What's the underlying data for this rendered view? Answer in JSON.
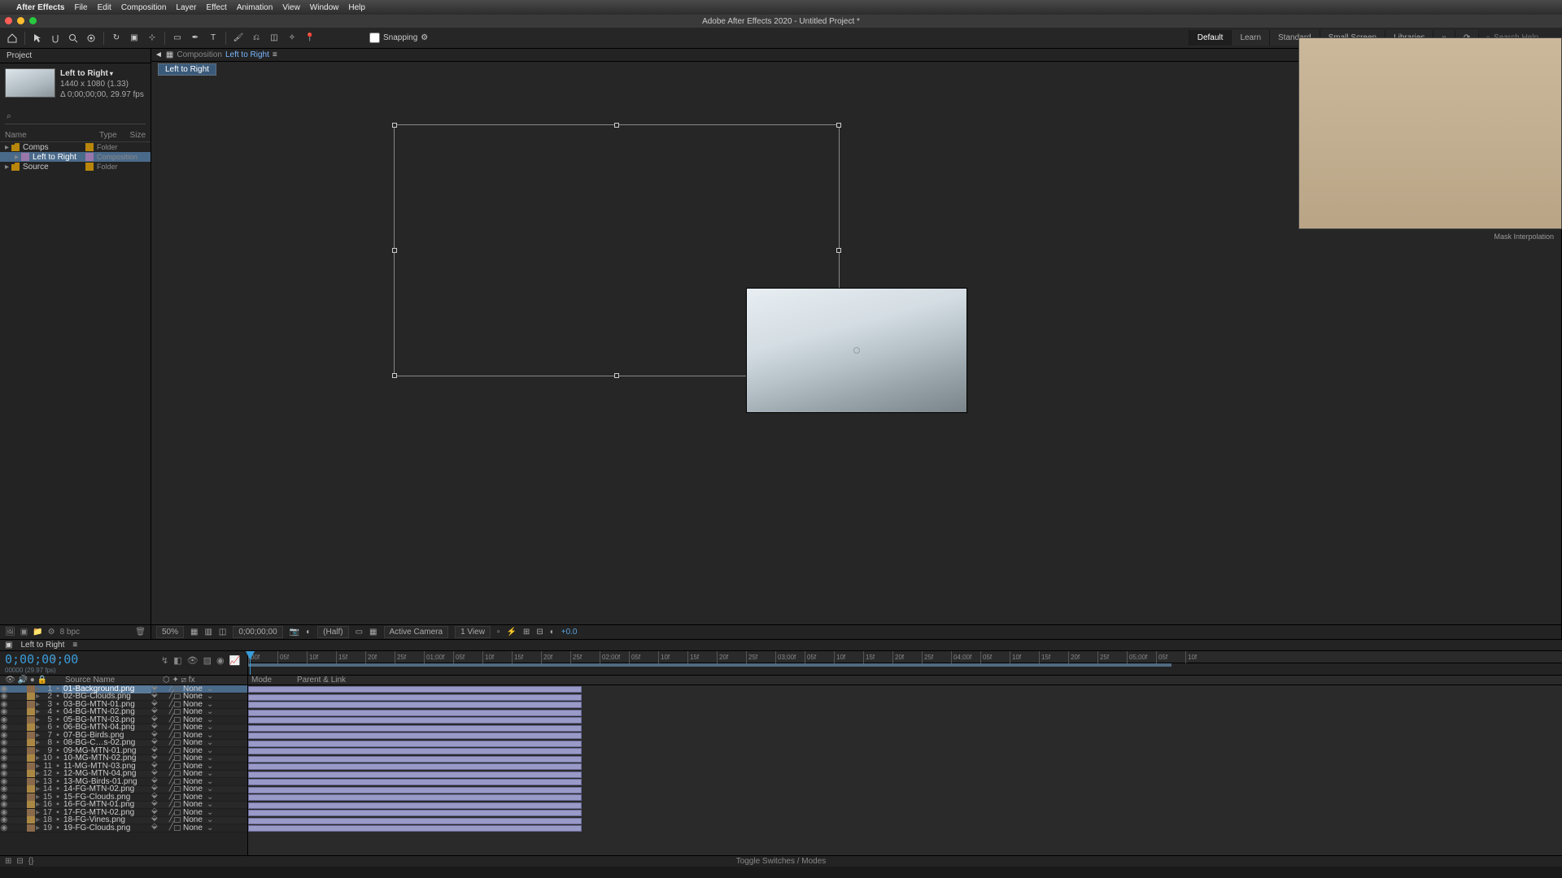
{
  "menubar": {
    "app": "After Effects",
    "items": [
      "File",
      "Edit",
      "Composition",
      "Layer",
      "Effect",
      "Animation",
      "View",
      "Window",
      "Help"
    ]
  },
  "titlebar": {
    "title": "Adobe After Effects 2020 - Untitled Project *"
  },
  "toolbar": {
    "snapping": "Snapping",
    "workspaces": [
      "Default",
      "Learn",
      "Standard",
      "Small Screen",
      "Libraries"
    ],
    "active_ws": 0,
    "search_placeholder": "Search Help"
  },
  "project_panel": {
    "tab": "Project",
    "selected_name": "Left to Right",
    "meta_line1": "1440 x 1080 (1.33)",
    "meta_line2": "Δ 0;00;00;00, 29.97 fps",
    "search_glyph": "⌕",
    "columns": {
      "name": "Name",
      "tag": "",
      "type": "Type",
      "size": "Size"
    },
    "tree": [
      {
        "label": "Comps",
        "type": "Folder",
        "icon": "folder",
        "indent": 0,
        "tag": "t1"
      },
      {
        "label": "Left to Right",
        "type": "Composition",
        "icon": "comp",
        "indent": 1,
        "selected": true,
        "tag": "t2"
      },
      {
        "label": "Source",
        "type": "Folder",
        "icon": "folder",
        "indent": 0,
        "tag": "t1"
      }
    ],
    "footer_bpc": "8 bpc"
  },
  "composition": {
    "crumb_prefix": "Composition",
    "crumb_name": "Left to Right",
    "flow_tab": "Left to Right",
    "footer": {
      "zoom": "50%",
      "time": "0;00;00;00",
      "res": "(Half)",
      "camera": "Active Camera",
      "view": "1 View",
      "exposure": "+0.0"
    }
  },
  "right": {
    "mask_interp": "Mask Interpolation"
  },
  "timeline": {
    "tab": "Left to Right",
    "timecode": "0;00;00;00",
    "timecode_sub": "00000 (29.97 fps)",
    "col_headers": {
      "source": "Source Name",
      "switches": "⬡ ✦ ⧄ fx",
      "mode": "Mode",
      "parent": "Parent & Link"
    },
    "ticks": [
      "00f",
      "05f",
      "10f",
      "15f",
      "20f",
      "25f",
      "01;00f",
      "05f",
      "10f",
      "15f",
      "20f",
      "25f",
      "02;00f",
      "05f",
      "10f",
      "15f",
      "20f",
      "25f",
      "03;00f",
      "05f",
      "10f",
      "15f",
      "20f",
      "25f",
      "04;00f",
      "05f",
      "10f",
      "15f",
      "20f",
      "25f",
      "05;00f",
      "05f",
      "10f"
    ],
    "layers": [
      {
        "n": 1,
        "name": "01-Background.png",
        "sel": true
      },
      {
        "n": 2,
        "name": "02-BG-Clouds.png"
      },
      {
        "n": 3,
        "name": "03-BG-MTN-01.png"
      },
      {
        "n": 4,
        "name": "04-BG-MTN-02.png"
      },
      {
        "n": 5,
        "name": "05-BG-MTN-03.png"
      },
      {
        "n": 6,
        "name": "06-BG-MTN-04.png"
      },
      {
        "n": 7,
        "name": "07-BG-Birds.png"
      },
      {
        "n": 8,
        "name": "08-BG-C…s-02.png"
      },
      {
        "n": 9,
        "name": "09-MG-MTN-01.png"
      },
      {
        "n": 10,
        "name": "10-MG-MTN-02.png"
      },
      {
        "n": 11,
        "name": "11-MG-MTN-03.png"
      },
      {
        "n": 12,
        "name": "12-MG-MTN-04.png"
      },
      {
        "n": 13,
        "name": "13-MG-Birds-01.png"
      },
      {
        "n": 14,
        "name": "14-FG-MTN-02.png"
      },
      {
        "n": 15,
        "name": "15-FG-Clouds.png"
      },
      {
        "n": 16,
        "name": "16-FG-MTN-01.png"
      },
      {
        "n": 17,
        "name": "17-FG-MTN-02.png"
      },
      {
        "n": 18,
        "name": "18-FG-Vines.png"
      },
      {
        "n": 19,
        "name": "19-FG-Clouds.png"
      }
    ],
    "mode_value": "None",
    "footer": "Toggle Switches / Modes"
  }
}
